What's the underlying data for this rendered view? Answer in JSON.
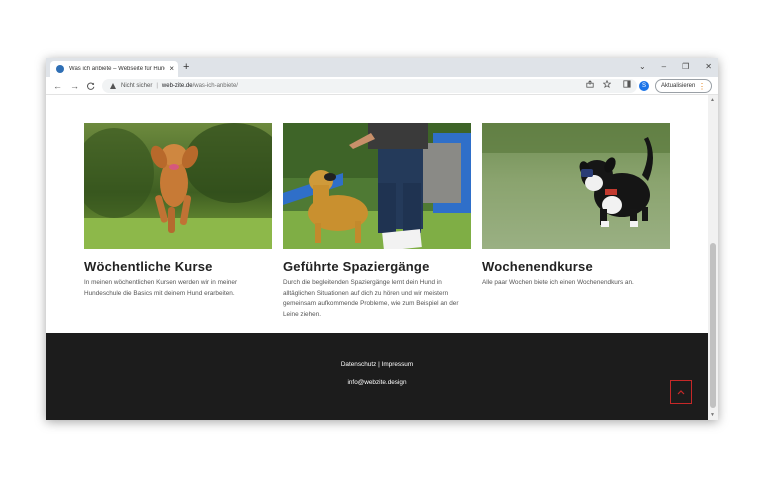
{
  "browser": {
    "tab_title": "Was ich anbiete – Webseite für Hundeschule",
    "tab_close": "×",
    "new_tab": "+",
    "window_controls": [
      "⌄",
      "–",
      "❐",
      "✕"
    ],
    "nav": {
      "back": "←",
      "forward": "→",
      "reload": "C"
    },
    "security_label": "Nicht sicher",
    "separator": "|",
    "url_host": "web-zite.de",
    "url_path": "/was-ich-anbiete/",
    "profile_initial": "S",
    "update_label": "Aktualisieren",
    "update_menu": "⋮",
    "icons": [
      "share-icon",
      "star-icon",
      "sidebar-icon"
    ]
  },
  "cards": [
    {
      "title": "Wöchentliche Kurse",
      "text": "In meinen wöchentlichen Kursen werden wir in meiner Hundeschule die Basics mit deinem Hund erarbeiten.",
      "image": "dog-running-on-grass-photo"
    },
    {
      "title": "Geführte Spaziergänge",
      "text": "Durch die begleitenden Spaziergänge lernt dein Hund in alltäglichen Situationen auf dich zu hören und wir meistern gemeinsam aufkommende Probleme, wie zum Beispiel an der Leine ziehen.",
      "image": "dog-with-trainer-photo"
    },
    {
      "title": "Wochenendkurse",
      "text": "Alle paar Wochen biete ich einen Wochenendkurs an.",
      "image": "puppy-with-toy-photo"
    }
  ],
  "footer": {
    "datenschutz": "Datenschutz",
    "separator": " | ",
    "impressum": "Impressum",
    "email": "info@webzite.design",
    "to_top_icon": "chevron-up-icon"
  },
  "colors": {
    "footer_bg": "#1c1c1c",
    "to_top_border": "#c62828",
    "tab_bar": "#dfe3e8"
  }
}
